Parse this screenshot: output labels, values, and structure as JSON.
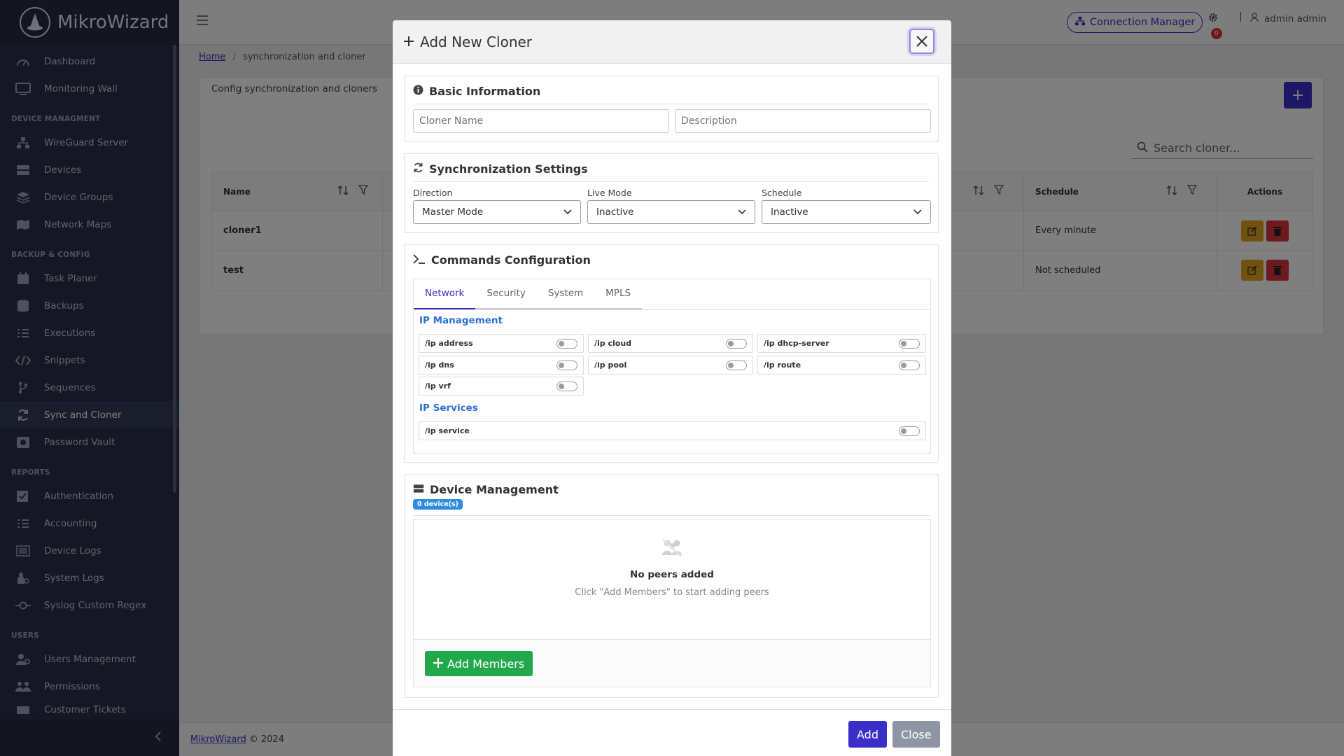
{
  "app": {
    "name": "MikroWizard"
  },
  "sidebar": {
    "items_top": [
      {
        "label": "Dashboard",
        "icon": "dashboard-gauge-icon"
      },
      {
        "label": "Monitoring Wall",
        "icon": "monitor-icon"
      }
    ],
    "section_device": "DEVICE MANAGMENT",
    "items_device": [
      {
        "label": "WireGuard Server",
        "icon": "network-icon"
      },
      {
        "label": "Devices",
        "icon": "server-icon"
      },
      {
        "label": "Device Groups",
        "icon": "layers-icon"
      },
      {
        "label": "Network Maps",
        "icon": "map-icon"
      }
    ],
    "section_backup": "BACKUP & CONFIG",
    "items_backup": [
      {
        "label": "Task Planer",
        "icon": "calendar-icon"
      },
      {
        "label": "Backups",
        "icon": "database-icon"
      },
      {
        "label": "Executions",
        "icon": "list-check-icon"
      },
      {
        "label": "Snippets",
        "icon": "code-icon"
      },
      {
        "label": "Sequences",
        "icon": "branch-icon"
      },
      {
        "label": "Sync and Cloner",
        "icon": "sync-icon",
        "active": true
      },
      {
        "label": "Password Vault",
        "icon": "vault-icon"
      }
    ],
    "section_reports": "REPORTS",
    "items_reports": [
      {
        "label": "Authentication",
        "icon": "auth-check-icon"
      },
      {
        "label": "Accounting",
        "icon": "list-check-icon"
      },
      {
        "label": "Device Logs",
        "icon": "log-list-icon"
      },
      {
        "label": "System Logs",
        "icon": "system-user-icon"
      },
      {
        "label": "Syslog Custom Regex",
        "icon": "commit-icon"
      }
    ],
    "section_users": "USERS",
    "items_users": [
      {
        "label": "Users Management",
        "icon": "user-gear-icon"
      },
      {
        "label": "Permissions",
        "icon": "people-icon"
      },
      {
        "label": "Customer Tickets",
        "icon": "ticket-icon"
      }
    ]
  },
  "header": {
    "connection_manager": "Connection Manager",
    "notification_count": "0",
    "separator": "|",
    "user_name": "admin admin"
  },
  "breadcrumb": {
    "home": "Home",
    "separator": "/",
    "current": "synchronization and cloner"
  },
  "page": {
    "card_title": "Config synchronization and cloners",
    "add_label": "+",
    "search_placeholder": "Search cloner...",
    "columns": {
      "name": "Name",
      "schedule": "Schedule",
      "actions": "Actions"
    },
    "rows": [
      {
        "name": "cloner1",
        "schedule": "Every minute"
      },
      {
        "name": "test",
        "schedule": "Not scheduled"
      }
    ]
  },
  "footer": {
    "brand_link": "MikroWizard",
    "copyright": "© 2024"
  },
  "modal": {
    "title": "Add New Cloner",
    "basic": {
      "title": "Basic Information",
      "name_placeholder": "Cloner Name",
      "description_placeholder": "Description"
    },
    "sync": {
      "title": "Synchronization Settings",
      "direction_label": "Direction",
      "direction_value": "Master Mode",
      "live_label": "Live Mode",
      "live_value": "Inactive",
      "schedule_label": "Schedule",
      "schedule_value": "Inactive"
    },
    "commands": {
      "title": "Commands Configuration",
      "tabs": [
        "Network",
        "Security",
        "System",
        "MPLS"
      ],
      "group1": "IP Management",
      "group1_items": [
        "/ip address",
        "/ip cloud",
        "/ip dhcp-server",
        "/ip dns",
        "/ip pool",
        "/ip route",
        "/ip vrf"
      ],
      "group2": "IP Services",
      "group2_items": [
        "/ip service"
      ]
    },
    "devices": {
      "title": "Device Management",
      "badge": "0 device(s)",
      "empty_title": "No peers added",
      "empty_hint": "Click \"Add Members\" to start adding peers",
      "add_members": "Add Members"
    },
    "footer": {
      "add": "Add",
      "close": "Close"
    }
  },
  "colors": {
    "accent": "#3b2fc9",
    "sidebar": "#2b2f48",
    "success": "#20a84a",
    "warning": "#e3a21a",
    "danger": "#d9353c",
    "info": "#2f8cde"
  }
}
